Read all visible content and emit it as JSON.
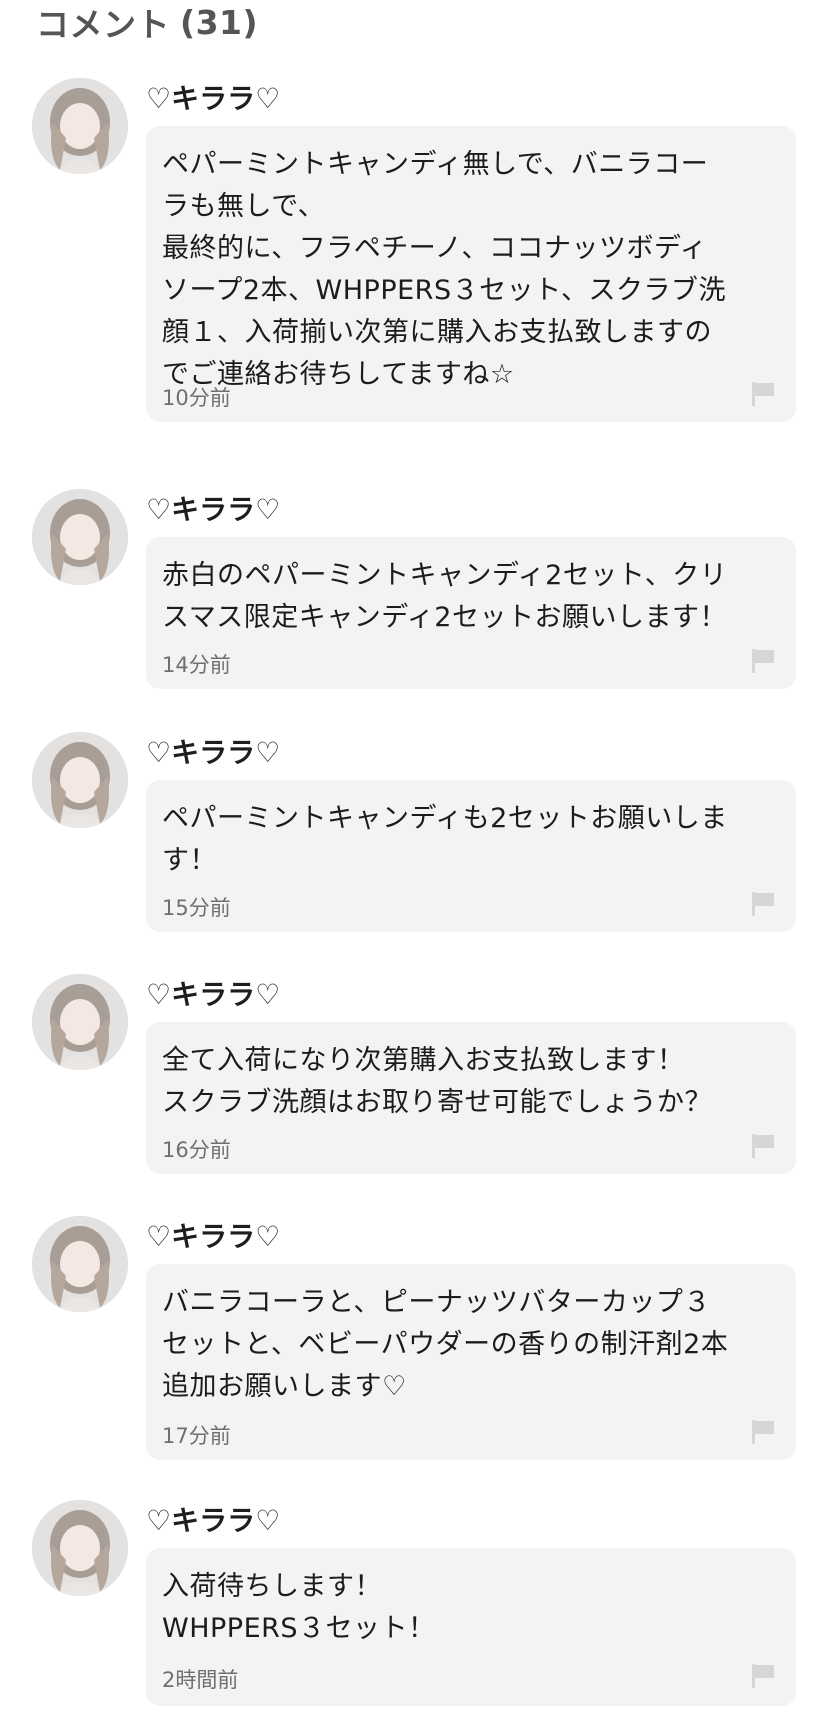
{
  "header": {
    "title": "コメント",
    "count": "(31)"
  },
  "comments": [
    {
      "user": "♡キララ♡",
      "text": "ペパーミントキャンディ無しで、バニラコー\nラも無しで、\n最終的に、フラペチーノ、ココナッツボディ\nソープ2本、WHPPERS３セット、スクラブ洗\n顔１、入荷揃い次第に購入お支払致しますの\nでご連絡お待ちしてますね☆",
      "time": "10分前"
    },
    {
      "user": "♡キララ♡",
      "text": "赤白のペパーミントキャンディ2セット、クリ\nスマス限定キャンディ2セットお願いします！",
      "time": "14分前"
    },
    {
      "user": "♡キララ♡",
      "text": "ペパーミントキャンディも2セットお願いしま\nす！",
      "time": "15分前"
    },
    {
      "user": "♡キララ♡",
      "text": "全て入荷になり次第購入お支払致します！\nスクラブ洗顔はお取り寄せ可能でしょうか？",
      "time": "16分前"
    },
    {
      "user": "♡キララ♡",
      "text": "バニラコーラと、ピーナッツバターカップ３\nセットと、ベビーパウダーの香りの制汗剤2本\n追加お願いします♡",
      "time": "17分前"
    },
    {
      "user": "♡キララ♡",
      "text": "入荷待ちします！\nWHPPERS３セット！",
      "time": "2時間前"
    }
  ],
  "icons": {
    "avatar": "user-avatar-photo",
    "report": "flag-icon"
  },
  "colors": {
    "bubble_bg": "#f3f3f3",
    "flag": "#d6d6d6",
    "header_text": "#555555"
  }
}
